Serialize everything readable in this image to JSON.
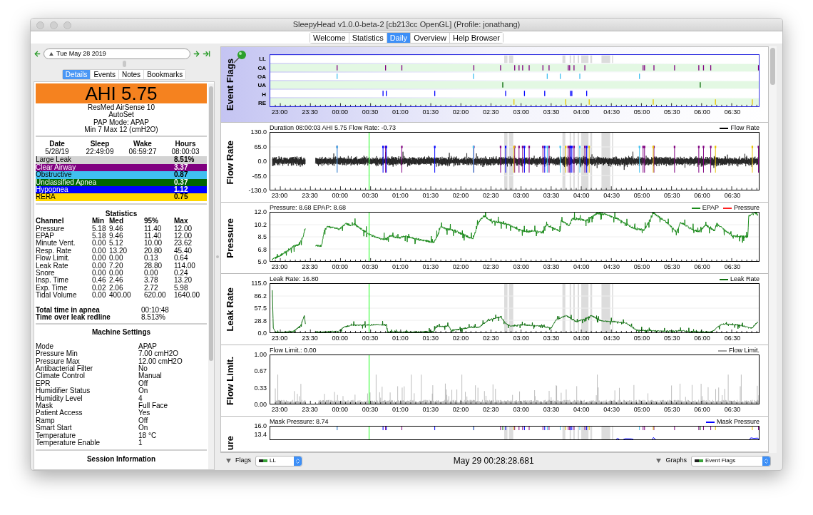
{
  "window": {
    "title": "SleepyHead v1.0.0-beta-2 [cb213cc OpenGL] (Profile: jonathang)"
  },
  "main_tabs": [
    {
      "label": "Welcome",
      "selected": false
    },
    {
      "label": "Statistics",
      "selected": false
    },
    {
      "label": "Daily",
      "selected": true
    },
    {
      "label": "Overview",
      "selected": false
    },
    {
      "label": "Help Browser",
      "selected": false
    }
  ],
  "date_bar": {
    "date": "Tue May 28 2019"
  },
  "detail_tabs": [
    {
      "label": "Details",
      "selected": true
    },
    {
      "label": "Events",
      "selected": false
    },
    {
      "label": "Notes",
      "selected": false
    },
    {
      "label": "Bookmarks",
      "selected": false
    }
  ],
  "ahi": "AHI 5.75",
  "machine": [
    "ResMed AirSense 10",
    "AutoSet",
    "PAP Mode: APAP",
    "Min 7 Max 12 (cmH2O)"
  ],
  "session_summary": {
    "columns": [
      "Date",
      "Sleep",
      "Wake",
      "Hours"
    ],
    "values": [
      "5/28/19",
      "22:49:09",
      "06:59:27",
      "08:00:03"
    ]
  },
  "event_indices": [
    {
      "name": "Large Leak",
      "value": "8.51%",
      "color": "#d3d3d3"
    },
    {
      "name": "Clear Airway",
      "value": "3.37",
      "color": "#800080"
    },
    {
      "name": "Obstructive",
      "value": "0.87",
      "color": "#40c0f0"
    },
    {
      "name": "Unclassified Apnea",
      "value": "0.37",
      "color": "#006400"
    },
    {
      "name": "Hypopnea",
      "value": "1.12",
      "color": "#0000ff"
    },
    {
      "name": "RERA",
      "value": "0.75",
      "color": "#ffd700"
    }
  ],
  "statistics": {
    "title": "Statistics",
    "columns": [
      "Channel",
      "Min",
      "Med",
      "95%",
      "Max"
    ],
    "rows": [
      [
        "Pressure",
        "5.18",
        "9.46",
        "11.40",
        "12.00"
      ],
      [
        "EPAP",
        "5.18",
        "9.46",
        "11.40",
        "12.00"
      ],
      [
        "Minute Vent.",
        "0.00",
        "5.12",
        "10.00",
        "23.62"
      ],
      [
        "Resp. Rate",
        "0.00",
        "13.20",
        "20.80",
        "45.40"
      ],
      [
        "Flow Limit.",
        "0.00",
        "0.00",
        "0.13",
        "0.64"
      ],
      [
        "Leak Rate",
        "0.00",
        "7.20",
        "28.80",
        "114.00"
      ],
      [
        "Snore",
        "0.00",
        "0.00",
        "0.00",
        "0.24"
      ],
      [
        "Insp. Time",
        "0.46",
        "2.46",
        "3.78",
        "13.20"
      ],
      [
        "Exp. Time",
        "0.02",
        "2.06",
        "2.72",
        "5.98"
      ],
      [
        "Tidal Volume",
        "0.00",
        "400.00",
        "620.00",
        "1640.00"
      ]
    ]
  },
  "totals": [
    {
      "label": "Total time in apnea",
      "value": "00:10:48"
    },
    {
      "label": "Time over leak redline",
      "value": "8.513%"
    }
  ],
  "machine_settings": {
    "title": "Machine Settings",
    "rows": [
      [
        "Mode",
        "APAP"
      ],
      [
        "Pressure Min",
        "7.00 cmH2O"
      ],
      [
        "Pressure Max",
        "12.00 cmH2O"
      ],
      [
        "Antibacterial Filter",
        "No"
      ],
      [
        "Climate Control",
        "Manual"
      ],
      [
        "EPR",
        "Off"
      ],
      [
        "Humidifier Status",
        "On"
      ],
      [
        "Humidity Level",
        "4"
      ],
      [
        "Mask",
        "Full Face"
      ],
      [
        "Patient Access",
        "Yes"
      ],
      [
        "Ramp",
        "Off"
      ],
      [
        "Smart Start",
        "On"
      ],
      [
        "Temperature",
        "18 °C"
      ],
      [
        "Temperature Enable",
        "1"
      ]
    ]
  },
  "session_information": {
    "title": "Session Information"
  },
  "graphs": [
    {
      "kind": "flags",
      "title": "Event Flags",
      "rows": [
        "LL",
        "CA",
        "OA",
        "UA",
        "H",
        "RE"
      ],
      "x_ticks": [
        "23:00",
        "23:30",
        "00:00",
        "00:30",
        "01:00",
        "01:30",
        "02:00",
        "02:30",
        "03:00",
        "03:30",
        "04:00",
        "04:30",
        "05:00",
        "05:30",
        "06:00",
        "06:30"
      ]
    },
    {
      "kind": "flow_wave",
      "title": "Flow Rate",
      "readout": "Duration 08:00:03 AHI 5.75 Flow Rate: -0.73",
      "legend": [
        {
          "name": "Flow Rate",
          "color": "#000000"
        }
      ],
      "y_ticks": [
        "130.0",
        "65.0",
        "0.0",
        "-65.0",
        "-130.0"
      ],
      "x_ticks": [
        "23:00",
        "23:30",
        "00:00",
        "00:30",
        "01:00",
        "01:30",
        "02:00",
        "02:30",
        "03:00",
        "03:30",
        "04:00",
        "04:30",
        "05:00",
        "05:30",
        "06:00",
        "06:30"
      ]
    },
    {
      "kind": "pressure_trace",
      "title": "Pressure",
      "readout": "Pressure: 8.68 EPAP: 8.68",
      "legend": [
        {
          "name": "EPAP",
          "color": "#1a8a1a"
        },
        {
          "name": "Pressure",
          "color": "#ff2020"
        }
      ],
      "y_ticks": [
        "12.0",
        "10.2",
        "8.5",
        "6.8",
        "5.0"
      ],
      "x_ticks": [
        "23:00",
        "23:30",
        "00:00",
        "00:30",
        "01:00",
        "01:30",
        "02:00",
        "02:30",
        "03:00",
        "03:30",
        "04:00",
        "04:30",
        "05:00",
        "05:30",
        "06:00",
        "06:30"
      ]
    },
    {
      "kind": "leak_trace",
      "title": "Leak Rate",
      "readout": "Leak Rate: 16.80",
      "legend": [
        {
          "name": "Leak Rate",
          "color": "#107010"
        }
      ],
      "y_ticks": [
        "115.0",
        "86.2",
        "57.5",
        "28.8",
        "0.0"
      ],
      "x_ticks": [
        "23:00",
        "23:30",
        "00:00",
        "00:30",
        "01:00",
        "01:30",
        "02:00",
        "02:30",
        "03:00",
        "03:30",
        "04:00",
        "04:30",
        "05:00",
        "05:30",
        "06:00",
        "06:30"
      ]
    },
    {
      "kind": "limit_wave",
      "title": "Flow Limit.",
      "readout": "Flow Limit.: 0.00",
      "legend": [
        {
          "name": "Flow Limit.",
          "color": "#a0a0a0"
        }
      ],
      "y_ticks": [
        "1.00",
        "0.67",
        "0.33",
        "0.00"
      ],
      "x_ticks": [
        "23:00",
        "23:30",
        "00:00",
        "00:30",
        "01:00",
        "01:30",
        "02:00",
        "02:30",
        "03:00",
        "03:30",
        "04:00",
        "04:30",
        "05:00",
        "05:30",
        "06:00",
        "06:30"
      ]
    },
    {
      "kind": "mask_partial",
      "title": "ure",
      "readout": "Mask Pressure: 8.74",
      "legend": [
        {
          "name": "Mask Pressure",
          "color": "#0000ff"
        }
      ],
      "y_ticks": [
        "16.0",
        "13.4"
      ]
    }
  ],
  "bottom_bar": {
    "flags_label": "Flags",
    "flags_value": "LL",
    "cursor_time": "May 29 00:28:28.681",
    "graphs_label": "Graphs",
    "graphs_value": "Event Flags"
  }
}
